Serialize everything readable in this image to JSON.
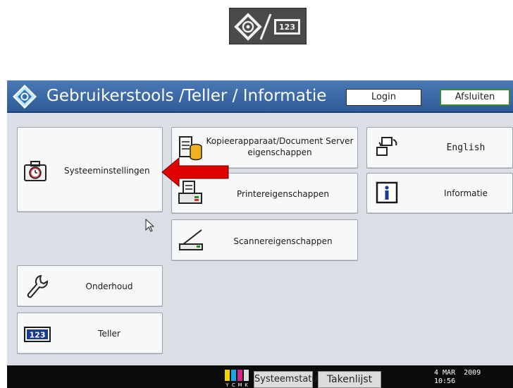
{
  "header": {
    "title": "Gebruikerstools /Teller / Informatie",
    "login_label": "Login",
    "exit_label": "Afsluiten"
  },
  "tiles": {
    "system_settings": "Systeeminstellingen",
    "copier_props": "Kopieerapparaat/Document Server\neigenschappen",
    "printer_props": "Printereigenschappen",
    "scanner_props": "Scannereigenschappen",
    "english": "English",
    "information": "Informatie",
    "maintenance": "Onderhoud",
    "counter": "Teller"
  },
  "status": {
    "system_status_label": "Systeemstatus",
    "job_list_label": "Takenlijst",
    "date": "4 MAR  2009",
    "time": "10:56",
    "toner_letters": [
      "Y",
      "C",
      "M",
      "K"
    ]
  },
  "hardware_key": {
    "counter_label": "123"
  },
  "colors": {
    "title_bar": "#3a69a6",
    "exit_border": "#3a8a3a",
    "arrow": "#e00000"
  }
}
